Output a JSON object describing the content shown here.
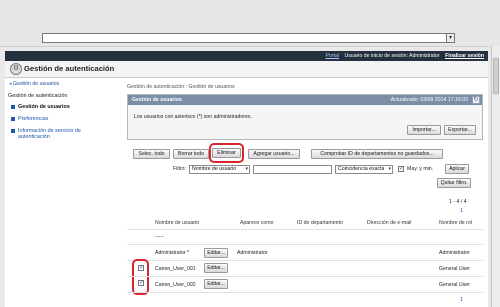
{
  "topnav": {
    "portal": "Portal",
    "login_user": "Usuario de inicio de sesión: Administrator",
    "logout": "Finalizar sesión"
  },
  "header": {
    "title": "Gestión de autenticación"
  },
  "sidebar": {
    "back": "Gestión de usuarios",
    "section": "Gestión de autenticación",
    "items": [
      {
        "label": "Gestión de usuarios"
      },
      {
        "label": "Preferencias"
      },
      {
        "label": "Información de servicio de",
        "label2": "autenticación"
      }
    ]
  },
  "breadcrumb": "Gestión de autenticación : Gestión de usuarios",
  "panel": {
    "title": "Gestión de usuarios",
    "updated": "Actualizado: 03/09 2014 17:16:03",
    "message": "Los usuarios con asterisco (*) son administradores.",
    "import_label": "Importar...",
    "export_label": "Exportar..."
  },
  "toolbar": {
    "select_all": "Selec. todo",
    "clear_all": "Borrar todo",
    "delete": "Eliminar",
    "add_user": "Agregar usuario...",
    "check_dept": "Comprobar ID de departamentos no guardados..."
  },
  "filter": {
    "label": "Filtro:",
    "field": "Nombre de usuario",
    "value": "",
    "match": "Coincidencia exacta",
    "case_label": "May. y min.",
    "apply": "Aplicar",
    "remove": "Quitar filtro."
  },
  "pagination": {
    "range": "1 - 4 / 4",
    "page": "1"
  },
  "table": {
    "columns": [
      "Nombre de usuario",
      "Aparece como",
      "ID de departamento",
      "Dirección de e-mail",
      "Nombre de rol"
    ],
    "edit_label": "Editar...",
    "rows": [
      {
        "name": "-----",
        "display": "",
        "dept": "",
        "email": "",
        "role": "",
        "checked": false,
        "has_checkbox": false,
        "has_edit": false
      },
      {
        "name": "Administrator",
        "star": "*",
        "display": "Administrator",
        "dept": "",
        "email": "",
        "role": "Administrator",
        "checked": false,
        "has_checkbox": false,
        "has_edit": true
      },
      {
        "name": "Canon_User_001",
        "display": "",
        "dept": "",
        "email": "",
        "role": "General User",
        "checked": true,
        "has_checkbox": true,
        "has_edit": true
      },
      {
        "name": "Canon_User_002",
        "display": "",
        "dept": "",
        "email": "",
        "role": "General User",
        "checked": true,
        "has_checkbox": true,
        "has_edit": true
      }
    ]
  },
  "pagination_bottom": {
    "page": "1"
  },
  "colors": {
    "navbar": "#25303e",
    "panel_head": "#7b8ea5",
    "highlight": "#d8262b",
    "link": "#1f55a6"
  }
}
